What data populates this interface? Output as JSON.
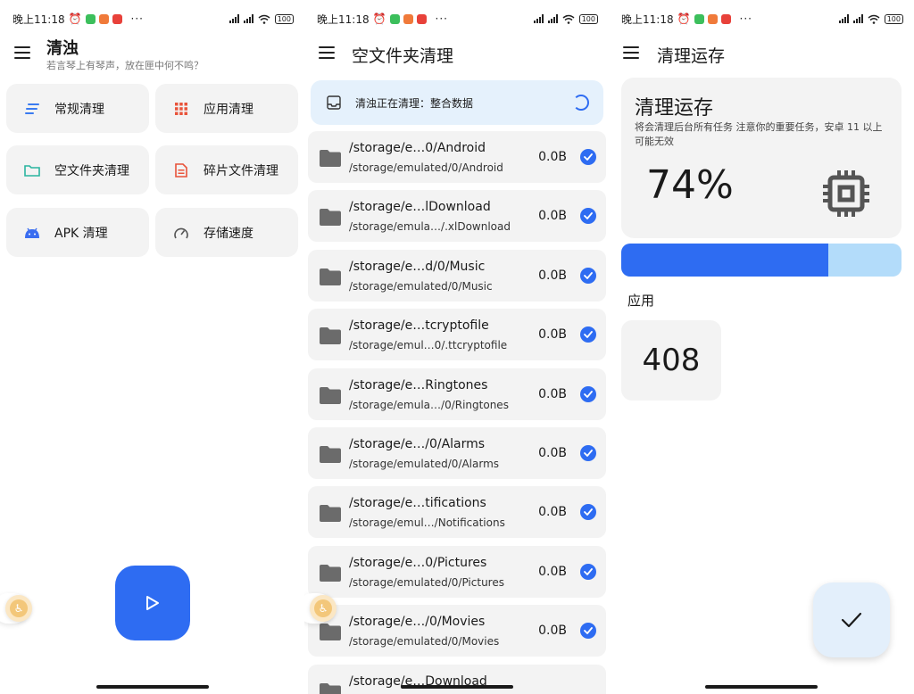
{
  "status_bar": {
    "time": "晚上11:18",
    "more": "···",
    "battery": "100"
  },
  "screen1": {
    "title": "清浊",
    "subtitle": "若言琴上有琴声，放在匣中何不鸣？",
    "tiles": [
      {
        "label": "常规清理",
        "icon": "lines-icon",
        "color": "#3a7bf0"
      },
      {
        "label": "应用清理",
        "icon": "grid-icon",
        "color": "#e8533a"
      },
      {
        "label": "空文件夹清理",
        "icon": "folder-icon",
        "color": "#2bb5a0"
      },
      {
        "label": "碎片文件清理",
        "icon": "document-icon",
        "color": "#e8533a"
      },
      {
        "label": "APK 清理",
        "icon": "android-icon",
        "color": "#3a6df0"
      },
      {
        "label": "存储速度",
        "icon": "speedometer-icon",
        "color": "#555555"
      }
    ]
  },
  "screen2": {
    "title": "空文件夹清理",
    "banner": "清浊正在清理：整合数据",
    "folders": [
      {
        "name": "/storage/e…0/Android",
        "path": "/storage/emulated/0/Android",
        "size": "0.0B"
      },
      {
        "name": "/storage/e…lDownload",
        "path": "/storage/emula…/.xlDownload",
        "size": "0.0B"
      },
      {
        "name": "/storage/e…d/0/Music",
        "path": "/storage/emulated/0/Music",
        "size": "0.0B"
      },
      {
        "name": "/storage/e…tcryptofile",
        "path": "/storage/emul…0/.ttcryptofile",
        "size": "0.0B"
      },
      {
        "name": "/storage/e…Ringtones",
        "path": "/storage/emula…/0/Ringtones",
        "size": "0.0B"
      },
      {
        "name": "/storage/e…/0/Alarms",
        "path": "/storage/emulated/0/Alarms",
        "size": "0.0B"
      },
      {
        "name": "/storage/e…tifications",
        "path": "/storage/emul…/Notifications",
        "size": "0.0B"
      },
      {
        "name": "/storage/e…0/Pictures",
        "path": "/storage/emulated/0/Pictures",
        "size": "0.0B"
      },
      {
        "name": "/storage/e…/0/Movies",
        "path": "/storage/emulated/0/Movies",
        "size": "0.0B"
      },
      {
        "name": "/storage/e…Download",
        "path": "",
        "size": ""
      }
    ]
  },
  "screen3": {
    "title": "清理运存",
    "card_title": "清理运存",
    "card_desc": "将会清理后台所有任务 注意你的重要任务，安卓 11 以上可能无效",
    "percent": "74%",
    "usage_fraction": 0.74,
    "apps_label": "应用",
    "apps_count": "408"
  },
  "colors": {
    "accent": "#2e6cf2",
    "bar_bg": "#b3dcfa",
    "banner_bg": "#e5f1fc",
    "card_bg": "#f3f3f3"
  }
}
